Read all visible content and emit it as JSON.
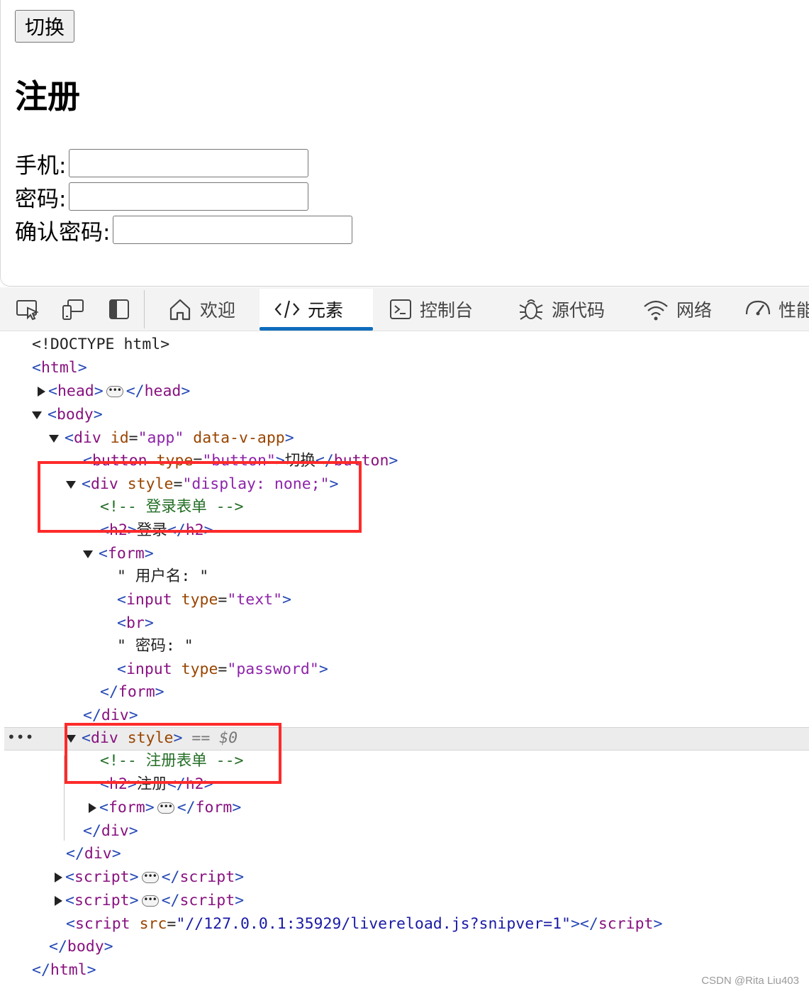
{
  "page": {
    "toggle_button": "切换",
    "title": "注册",
    "fields": [
      {
        "label": "手机:"
      },
      {
        "label": "密码:"
      },
      {
        "label": "确认密码:"
      }
    ]
  },
  "devtools": {
    "tabs": [
      {
        "label": "欢迎",
        "icon": "home-icon"
      },
      {
        "label": "元素",
        "icon": "code-brackets-icon",
        "active": true
      },
      {
        "label": "控制台",
        "icon": "console-icon"
      },
      {
        "label": "源代码",
        "icon": "bug-icon"
      },
      {
        "label": "网络",
        "icon": "wifi-icon"
      },
      {
        "label": "性能",
        "icon": "gauge-icon"
      }
    ],
    "tree": {
      "doctype": "<!DOCTYPE html>",
      "html_open": "html",
      "head": "head",
      "body": "body",
      "div": "div",
      "id_attr": "id",
      "app_val": "\"app\"",
      "data_v_app": "data-v-app",
      "button": "button",
      "type_attr": "type",
      "button_val": "\"button\"",
      "button_text": "切换",
      "style_attr": "style",
      "display_none_val": "\"display: none;\"",
      "login_comment": "<!-- 登录表单 -->",
      "h2": "h2",
      "login_text": "登录",
      "form": "form",
      "username_text": "\" 用户名: \"",
      "input": "input",
      "text_val": "\"text\"",
      "br": "br",
      "password_text": "\" 密码: \"",
      "password_val": "\"password\"",
      "eq_dollar": " == $0",
      "register_comment": "<!-- 注册表单 -->",
      "register_text": "注册",
      "script": "script",
      "src_attr": "src",
      "livereload_val": "\"//127.0.0.1:35929/livereload.js?snipver=1\""
    }
  },
  "watermark": "CSDN @Rita Liu403",
  "colors": {
    "tag": "#881280",
    "bracket": "#2549b5",
    "attr_name": "#994500",
    "attr_value": "#8e24aa",
    "comment": "#236e25",
    "active_tab_underline": "#0f6cbd",
    "highlight_box": "#ff2a2a"
  }
}
